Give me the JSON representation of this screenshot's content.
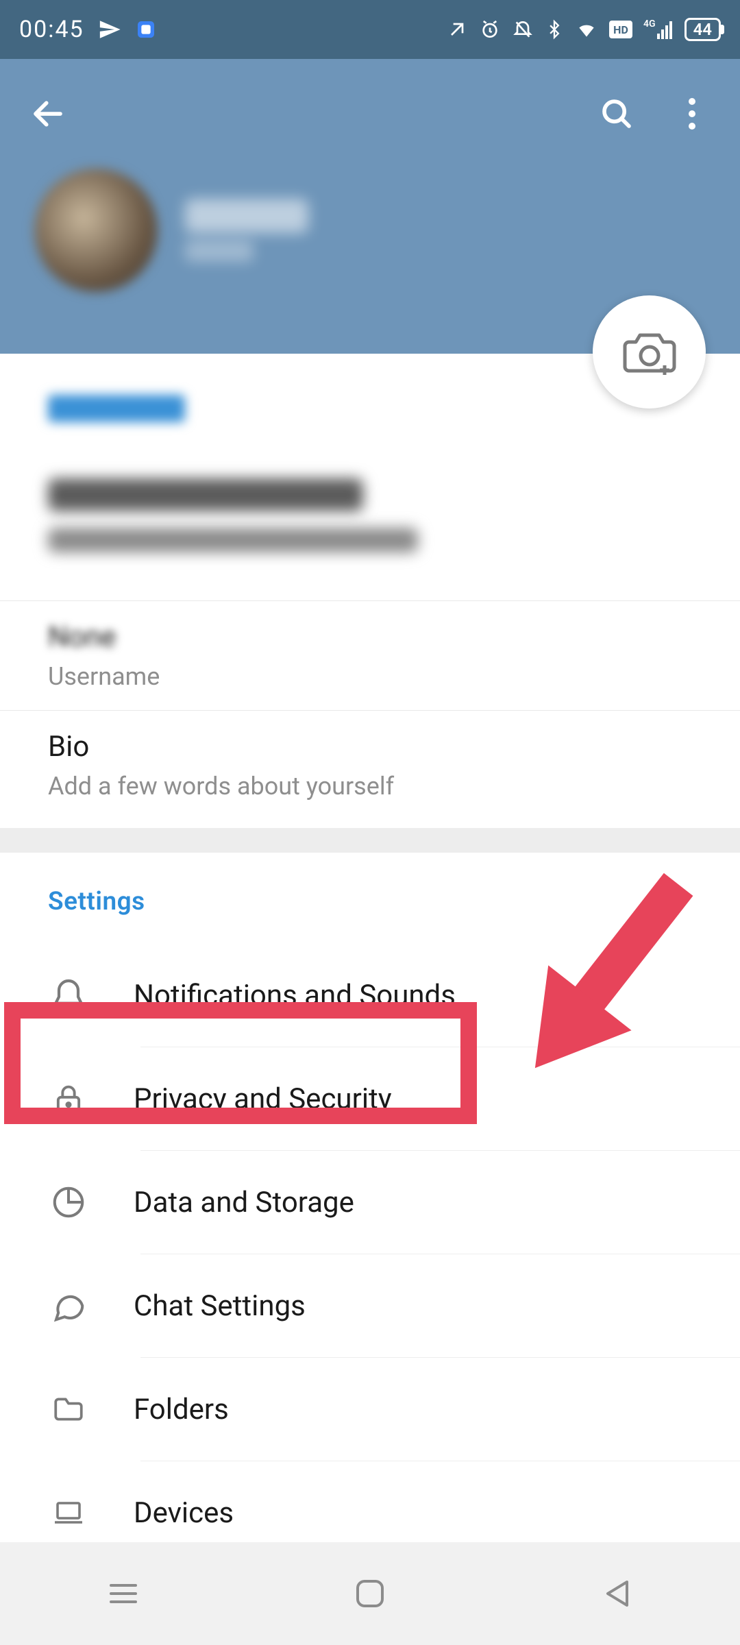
{
  "status_bar": {
    "time": "00:45",
    "battery": "44",
    "icons": [
      "telegram",
      "app",
      "nfc",
      "alarm",
      "dnd",
      "bluetooth",
      "wifi",
      "hd",
      "signal-4g"
    ]
  },
  "header": {
    "profile_name": "",
    "profile_status": ""
  },
  "account": {
    "section_title": "Account",
    "username_value": "None",
    "username_label": "Username",
    "bio_value": "Bio",
    "bio_label": "Add a few words about yourself"
  },
  "settings": {
    "section_title": "Settings",
    "items": [
      {
        "label": "Notifications and Sounds",
        "icon": "bell"
      },
      {
        "label": "Privacy and Security",
        "icon": "lock"
      },
      {
        "label": "Data and Storage",
        "icon": "pie"
      },
      {
        "label": "Chat Settings",
        "icon": "chat"
      },
      {
        "label": "Folders",
        "icon": "folder"
      },
      {
        "label": "Devices",
        "icon": "laptop"
      }
    ]
  },
  "annotation": {
    "highlighted_item_index": 1
  }
}
